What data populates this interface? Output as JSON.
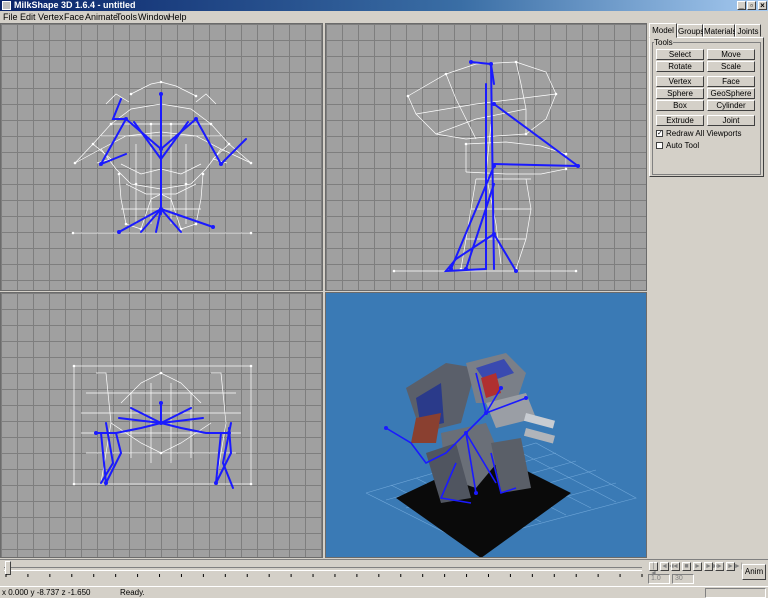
{
  "window": {
    "title": "MilkShape 3D 1.6.4 - untitled",
    "controls": [
      "_",
      "▫",
      "×"
    ]
  },
  "menu": [
    "File",
    "Edit",
    "Vertex",
    "Face",
    "Animate",
    "Tools",
    "Window",
    "Help"
  ],
  "tabs": [
    "Model",
    "Groups",
    "Materials",
    "Joints"
  ],
  "active_tab": "Model",
  "tools": {
    "group_label": "Tools",
    "buttons": [
      "Select",
      "Move",
      "Rotate",
      "Scale",
      "Vertex",
      "Face",
      "Sphere",
      "GeoSphere",
      "Box",
      "Cylinder",
      "Extrude",
      "Joint"
    ],
    "options": [
      {
        "label": "Redraw All Viewports",
        "checked": true
      },
      {
        "label": "Auto Tool",
        "checked": false
      }
    ]
  },
  "viewports": {
    "perspective_background": "#3a7ab5",
    "wire_color": "#ffffff",
    "joint_color": "#1a1aff"
  },
  "timeline": {
    "playback_buttons": [
      "|◄",
      "◄◄",
      "◄",
      "■",
      "►",
      "►►",
      "►|",
      "►►|"
    ],
    "frame_current": "1.0",
    "frame_total": "30",
    "anim_button": "Anim"
  },
  "status": {
    "coordinates": "x 0.000 y -8.737 z -1.650",
    "message": "Ready."
  }
}
